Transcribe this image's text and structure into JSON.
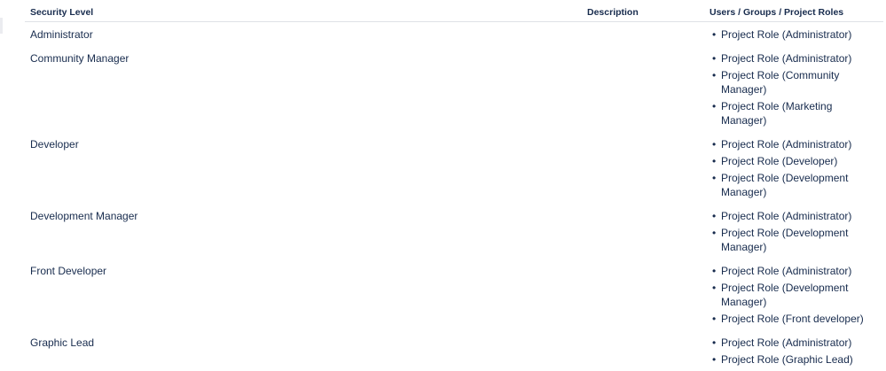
{
  "table": {
    "headers": {
      "security_level": "Security Level",
      "description": "Description",
      "roles": "Users / Groups / Project Roles"
    },
    "rows": [
      {
        "level": "Administrator",
        "description": "",
        "roles": [
          "Project Role (Administrator)"
        ]
      },
      {
        "level": "Community Manager",
        "description": "",
        "roles": [
          "Project Role (Administrator)",
          "Project Role (Community Manager)",
          "Project Role (Marketing Manager)"
        ]
      },
      {
        "level": "Developer",
        "description": "",
        "roles": [
          "Project Role (Administrator)",
          "Project Role (Developer)",
          "Project Role (Development Manager)"
        ]
      },
      {
        "level": "Development Manager",
        "description": "",
        "roles": [
          "Project Role (Administrator)",
          "Project Role (Development Manager)"
        ]
      },
      {
        "level": "Front Developer",
        "description": "",
        "roles": [
          "Project Role (Administrator)",
          "Project Role (Development Manager)",
          "Project Role (Front developer)"
        ]
      },
      {
        "level": "Graphic Lead",
        "description": "",
        "roles": [
          "Project Role (Administrator)",
          "Project Role (Graphic Lead)"
        ]
      }
    ]
  }
}
